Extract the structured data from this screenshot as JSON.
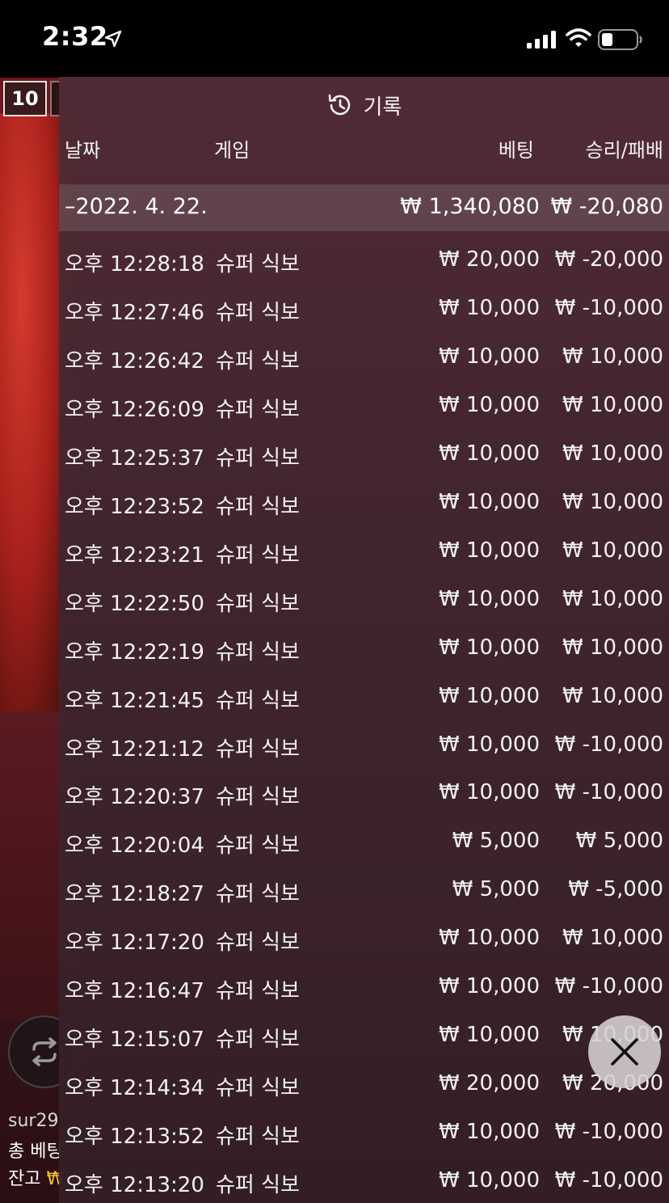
{
  "status_bar": {
    "time": "2:32"
  },
  "background": {
    "badge_number": "10",
    "user_name": "sur29",
    "total_bet_label": "총 베팅",
    "balance_label": "잔고",
    "currency_symbol": "₩"
  },
  "history": {
    "title": "기록",
    "columns": {
      "date": "날짜",
      "game": "게임",
      "bet": "베팅",
      "win_loss": "승리/패배"
    },
    "date_group": {
      "date": "–2022. 4. 22.",
      "total_bet": "₩ 1,340,080",
      "total_result": "₩ -20,080"
    },
    "rows": [
      {
        "time": "오후 12:28:18",
        "game": "슈퍼 식보",
        "bet": "₩ 20,000",
        "result": "₩ -20,000"
      },
      {
        "time": "오후 12:27:46",
        "game": "슈퍼 식보",
        "bet": "₩ 10,000",
        "result": "₩ -10,000"
      },
      {
        "time": "오후 12:26:42",
        "game": "슈퍼 식보",
        "bet": "₩ 10,000",
        "result": "₩ 10,000"
      },
      {
        "time": "오후 12:26:09",
        "game": "슈퍼 식보",
        "bet": "₩ 10,000",
        "result": "₩ 10,000"
      },
      {
        "time": "오후 12:25:37",
        "game": "슈퍼 식보",
        "bet": "₩ 10,000",
        "result": "₩ 10,000"
      },
      {
        "time": "오후 12:23:52",
        "game": "슈퍼 식보",
        "bet": "₩ 10,000",
        "result": "₩ 10,000"
      },
      {
        "time": "오후 12:23:21",
        "game": "슈퍼 식보",
        "bet": "₩ 10,000",
        "result": "₩ 10,000"
      },
      {
        "time": "오후 12:22:50",
        "game": "슈퍼 식보",
        "bet": "₩ 10,000",
        "result": "₩ 10,000"
      },
      {
        "time": "오후 12:22:19",
        "game": "슈퍼 식보",
        "bet": "₩ 10,000",
        "result": "₩ 10,000"
      },
      {
        "time": "오후 12:21:45",
        "game": "슈퍼 식보",
        "bet": "₩ 10,000",
        "result": "₩ 10,000"
      },
      {
        "time": "오후 12:21:12",
        "game": "슈퍼 식보",
        "bet": "₩ 10,000",
        "result": "₩ -10,000"
      },
      {
        "time": "오후 12:20:37",
        "game": "슈퍼 식보",
        "bet": "₩ 10,000",
        "result": "₩ -10,000"
      },
      {
        "time": "오후 12:20:04",
        "game": "슈퍼 식보",
        "bet": "₩ 5,000",
        "result": "₩ 5,000"
      },
      {
        "time": "오후 12:18:27",
        "game": "슈퍼 식보",
        "bet": "₩ 5,000",
        "result": "₩ -5,000"
      },
      {
        "time": "오후 12:17:20",
        "game": "슈퍼 식보",
        "bet": "₩ 10,000",
        "result": "₩ 10,000"
      },
      {
        "time": "오후 12:16:47",
        "game": "슈퍼 식보",
        "bet": "₩ 10,000",
        "result": "₩ -10,000"
      },
      {
        "time": "오후 12:15:07",
        "game": "슈퍼 식보",
        "bet": "₩ 10,000",
        "result": "₩ 10,000"
      },
      {
        "time": "오후 12:14:34",
        "game": "슈퍼 식보",
        "bet": "₩ 20,000",
        "result": "₩ 20,000"
      },
      {
        "time": "오후 12:13:52",
        "game": "슈퍼 식보",
        "bet": "₩ 10,000",
        "result": "₩ -10,000"
      },
      {
        "time": "오후 12:13:20",
        "game": "슈퍼 식보",
        "bet": "₩ 10,000",
        "result": "₩ -10,000"
      }
    ]
  },
  "colors": {
    "panel_bg": "#4e2c36",
    "accent_gold": "#f0c030"
  },
  "icons": [
    "location-arrow-icon",
    "signal-icon",
    "wifi-icon",
    "battery-icon",
    "history-icon",
    "repeat-icon",
    "close-icon"
  ]
}
